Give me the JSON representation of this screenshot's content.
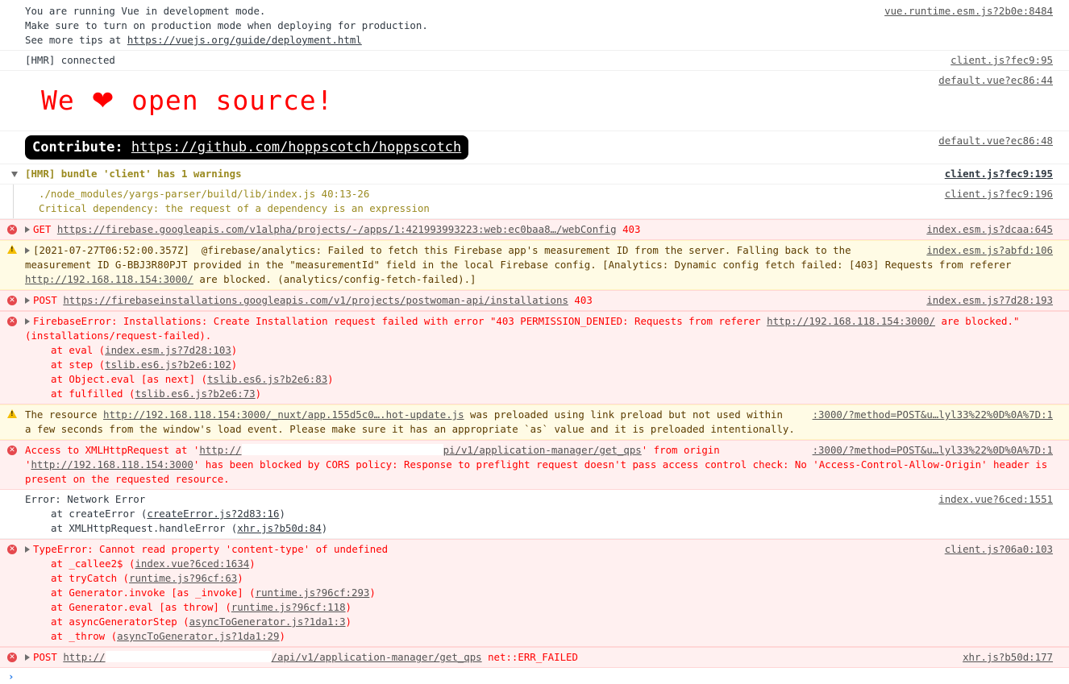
{
  "vue_dev": {
    "lines": [
      "You are running Vue in development mode.",
      "Make sure to turn on production mode when deploying for production.",
      "See more tips at "
    ],
    "link": "https://vuejs.org/guide/deployment.html",
    "source": "vue.runtime.esm.js?2b0e:8484"
  },
  "hmr_connected": {
    "text": "[HMR] connected",
    "source": "client.js?fec9:95"
  },
  "open_source": {
    "text_before": "We ",
    "heart": "❤",
    "text_after": " open source!",
    "source": "default.vue?ec86:44"
  },
  "contribute": {
    "label": "Contribute: ",
    "link": "https://github.com/hoppscotch/hoppscotch",
    "source": "default.vue?ec86:48"
  },
  "hmr_warning_group": {
    "title": "[HMR] bundle 'client' has 1 warnings",
    "source": "client.js?fec9:195",
    "child_lines": [
      "./node_modules/yargs-parser/build/lib/index.js 40:13-26",
      "Critical dependency: the request of a dependency is an expression"
    ],
    "child_source": "client.js?fec9:196"
  },
  "get_error": {
    "method": "GET ",
    "url": "https://firebase.googleapis.com/v1alpha/projects/-/apps/1:421993993223:web:ec0baa8…/webConfig",
    "status": " 403",
    "source": "index.esm.js?dcaa:645"
  },
  "analytics_warning": {
    "text_1": "[2021-07-27T06:52:00.357Z]  @firebase/analytics: Failed to fetch this Firebase app's measurement ID from the server. Falling back to the measurement ID G-BBJ3R80PJT provided in the \"measurementId\" field in the local Firebase config. [Analytics: Dynamic config fetch failed: [403] Requests from referer ",
    "link": "http://192.168.118.154:3000/",
    "text_2": " are blocked. (analytics/config-fetch-failed).]",
    "source": "index.esm.js?abfd:106"
  },
  "post_error_1": {
    "method": "POST ",
    "url": "https://firebaseinstallations.googleapis.com/v1/projects/postwoman-api/installations",
    "status": " 403",
    "source": "index.esm.js?7d28:193"
  },
  "firebase_error": {
    "text_1": "FirebaseError: Installations: Create Installation request failed with error \"403 PERMISSION_DENIED: Requests from referer ",
    "link": "http://192.168.118.154:3000/",
    "text_2": " are blocked.\" (installations/request-failed).",
    "stack": [
      {
        "prefix": "at eval (",
        "link": "index.esm.js?7d28:103",
        "suffix": ")"
      },
      {
        "prefix": "at step (",
        "link": "tslib.es6.js?b2e6:102",
        "suffix": ")"
      },
      {
        "prefix": "at Object.eval [as next] (",
        "link": "tslib.es6.js?b2e6:83",
        "suffix": ")"
      },
      {
        "prefix": "at fulfilled (",
        "link": "tslib.es6.js?b2e6:73",
        "suffix": ")"
      }
    ]
  },
  "preload_warning": {
    "text_1": "The resource ",
    "link": "http://192.168.118.154:3000/_nuxt/app.155d5c0….hot-update.js",
    "text_2": " was preloaded using link preload but not used within a few seconds from the window's load event. Please make sure it has an appropriate `as` value and it is preloaded intentionally.",
    "source": ":3000/?method=POST&u…lyl33%22%0D%0A%7D:1"
  },
  "cors_error": {
    "text_1": "Access to XMLHttpRequest at '",
    "link_start": "http://",
    "link_end": "pi/v1/application-manager/get_qps",
    "text_2": "' from origin '",
    "origin": "http://192.168.118.154:3000",
    "text_3": "' has been blocked by CORS policy: Response to preflight request doesn't pass access control check: No 'Access-Control-Allow-Origin' header is present on the requested resource.",
    "source": ":3000/?method=POST&u…lyl33%22%0D%0A%7D:1"
  },
  "network_error": {
    "text": "Error: Network Error",
    "source": "index.vue?6ced:1551",
    "stack": [
      {
        "prefix": "at createError (",
        "link": "createError.js?2d83:16",
        "suffix": ")"
      },
      {
        "prefix": "at XMLHttpRequest.handleError (",
        "link": "xhr.js?b50d:84",
        "suffix": ")"
      }
    ]
  },
  "type_error": {
    "text": "TypeError: Cannot read property 'content-type' of undefined",
    "source": "client.js?06a0:103",
    "stack": [
      {
        "prefix": "at _callee2$ (",
        "link": "index.vue?6ced:1634",
        "suffix": ")"
      },
      {
        "prefix": "at tryCatch (",
        "link": "runtime.js?96cf:63",
        "suffix": ")"
      },
      {
        "prefix": "at Generator.invoke [as _invoke] (",
        "link": "runtime.js?96cf:293",
        "suffix": ")"
      },
      {
        "prefix": "at Generator.eval [as throw] (",
        "link": "runtime.js?96cf:118",
        "suffix": ")"
      },
      {
        "prefix": "at asyncGeneratorStep (",
        "link": "asyncToGenerator.js?1da1:3",
        "suffix": ")"
      },
      {
        "prefix": "at _throw (",
        "link": "asyncToGenerator.js?1da1:29",
        "suffix": ")"
      }
    ]
  },
  "post_error_2": {
    "method": "POST ",
    "url_start": "http://",
    "url_end": "/api/v1/application-manager/get_qps",
    "status": " net::ERR_FAILED",
    "source": "xhr.js?b50d:177"
  },
  "prompt": {
    "symbol": "›"
  }
}
